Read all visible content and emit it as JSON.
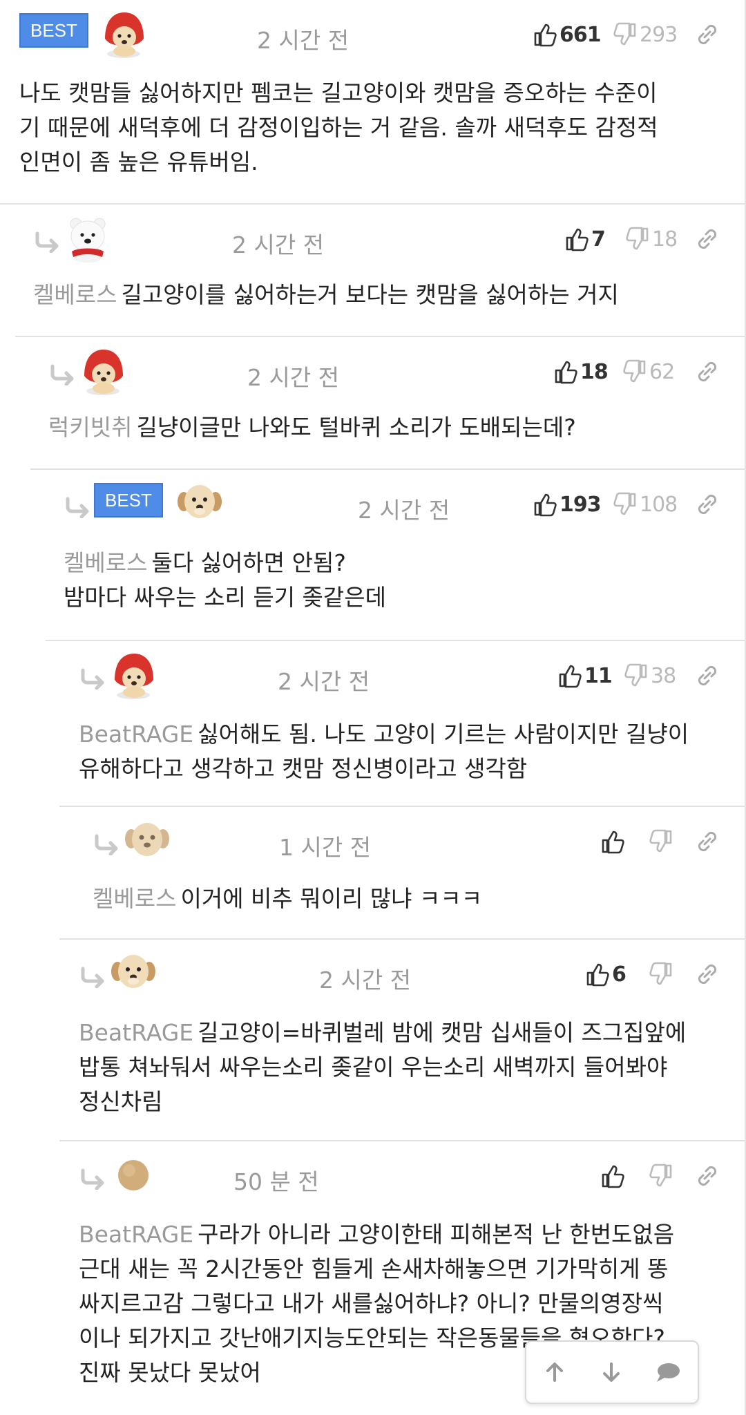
{
  "comments": [
    {
      "best": "BEST",
      "time": "2 시간 전",
      "likes": "661",
      "dislikes": "293",
      "mention": "",
      "lines": [
        "나도 캣맘들 싫어하지만 펨코는 길고양이와 캣맘을 증오하는 수준이",
        "기 때문에 새덕후에 더 감정이입하는 거 같음. 솔까 새덕후도 감정적",
        "인면이 좀 높은 유튜버임."
      ],
      "avatar": "red-hood-puppy"
    },
    {
      "time": "2 시간 전",
      "likes": "7",
      "dislikes": "18",
      "mention": "켈베로스",
      "lines": [
        "길고양이를 싫어하는거 보다는 캣맘을 싫어하는 거지"
      ],
      "avatar": "white-bear"
    },
    {
      "time": "2 시간 전",
      "likes": "18",
      "dislikes": "62",
      "mention": "럭키빗취",
      "lines": [
        "길냥이글만 나와도 털바퀴 소리가 도배되는데?"
      ],
      "avatar": "red-hood-puppy"
    },
    {
      "best": "BEST",
      "time": "2 시간 전",
      "likes": "193",
      "dislikes": "108",
      "mention": "켈베로스",
      "lines": [
        "둘다 싫어하면 안됨?",
        "밤마다 싸우는 소리 듣기 좆같은데"
      ],
      "avatar": "puppy"
    },
    {
      "time": "2 시간 전",
      "likes": "11",
      "dislikes": "38",
      "mention": "BeatRAGE",
      "lines": [
        "싫어해도 됨. 나도 고양이 기르는 사람이지만 길냥이",
        "유해하다고 생각하고 캣맘 정신병이라고 생각함"
      ],
      "avatar": "red-hood-puppy"
    },
    {
      "time": "1 시간 전",
      "likes": "",
      "dislikes": "",
      "mention": "켈베로스",
      "lines": [
        "이거에 비추 뭐이리 많냐 ㅋㅋㅋ"
      ],
      "avatar": "blurred-puppy"
    },
    {
      "time": "2 시간 전",
      "likes": "6",
      "dislikes": "",
      "mention": "BeatRAGE",
      "lines": [
        "길고양이=바퀴벌레 밤에 캣맘 십새들이 즈그집앞에",
        "밥통 쳐놔둬서 싸우는소리 좆같이 우는소리 새벽까지 들어봐야",
        "정신차림"
      ],
      "avatar": "puppy"
    },
    {
      "time": "50 분 전",
      "likes": "",
      "dislikes": "",
      "mention": "BeatRAGE",
      "lines": [
        "구라가 아니라 고양이한태 피해본적 난 한번도없음",
        "근대 새는 꼭 2시간동안 힘들게 손새차해놓으면 기가막히게 똥",
        "싸지르고감 그렇다고 내가 새를싫어하냐? 아니? 만물의영장씩",
        "이나 되가지고 갓난애기지능도안되는 작은동물들을 혐오한다?",
        "진짜 못났다 못났어"
      ],
      "avatar": "round-tan"
    }
  ],
  "floating_nav": {
    "up_icon": "arrow-up-icon",
    "down_icon": "arrow-down-icon",
    "comment_icon": "comment-bubble-icon"
  },
  "colors": {
    "best_badge": "#4f8ce8",
    "mention": "#9a9a9a",
    "time": "#9a9a9a"
  }
}
